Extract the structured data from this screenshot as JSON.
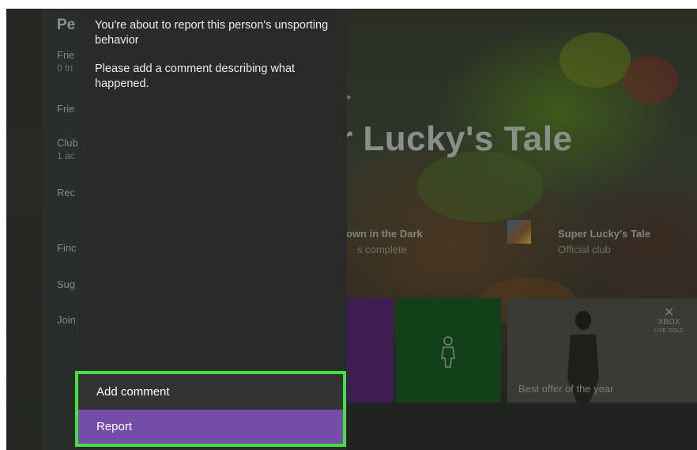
{
  "people_panel": {
    "title": "Pe",
    "friends_label": "Frie",
    "friends_count": "0 fri",
    "friends2_label": "Frie",
    "clubs_label": "Club",
    "clubs_count": "1 ac",
    "recent_label": "Rec",
    "find_label": "Finc",
    "suggested_label": "Sug",
    "join_label": "Join"
  },
  "background": {
    "game_title": "er Lucky's Tale",
    "activity_title": "own in the Dark",
    "activity_sub": "s complete",
    "club_title": "Super Lucky's Tale",
    "club_sub": "Official club",
    "xbox_logo_text": "XBOX",
    "xbox_logo_sub": "LIVE GOLD",
    "offer_text": "Best offer of the year"
  },
  "dialog": {
    "heading": "You're about to report this person's unsporting behavior",
    "body": "Please add a comment describing what happened.",
    "add_comment_label": "Add comment",
    "report_label": "Report"
  },
  "colors": {
    "accent_purple": "#744da9",
    "highlight_green": "#3fe43f",
    "dialog_bg": "#2a2a2a"
  }
}
